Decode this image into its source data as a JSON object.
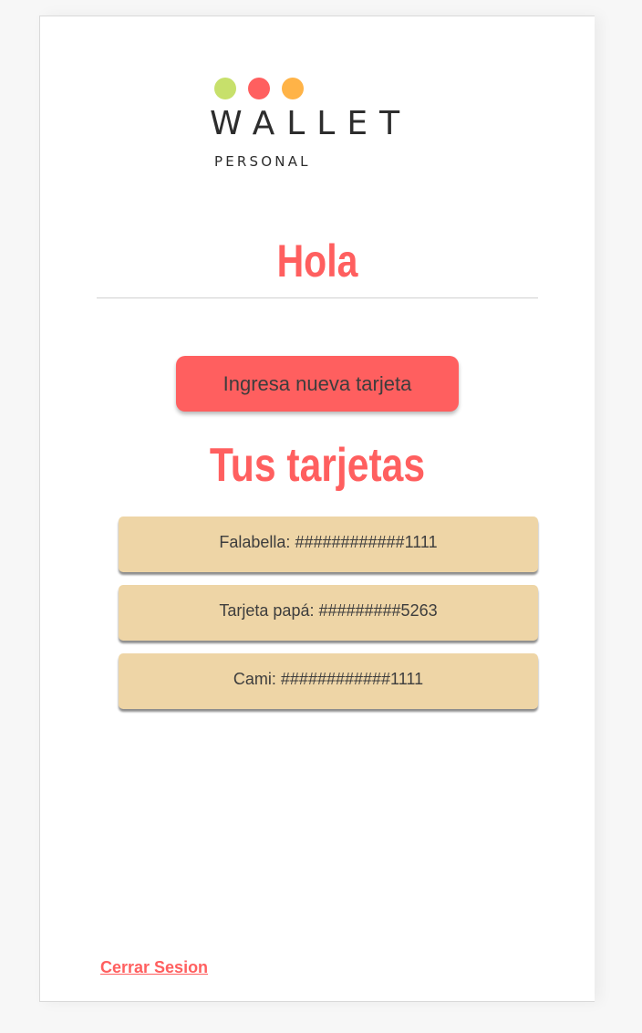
{
  "brand": {
    "name": "WALLET",
    "tagline": "PERSONAL",
    "dot_colors": [
      "#c7e06b",
      "#ff5f5f",
      "#ffb347"
    ]
  },
  "header": {
    "greeting": "Hola"
  },
  "actions": {
    "add_card_label": "Ingresa nueva tarjeta"
  },
  "cards_section": {
    "title": "Tus tarjetas",
    "cards": [
      {
        "label": "Falabella: ############1111"
      },
      {
        "label": "Tarjeta papá: #########5263"
      },
      {
        "label": "Cami: ############1111"
      }
    ]
  },
  "footer": {
    "logout_label": "Cerrar Sesion"
  },
  "colors": {
    "accent": "#ff5f5f",
    "card_bg": "#eed5a6",
    "text_dark": "#3d3d3d"
  }
}
